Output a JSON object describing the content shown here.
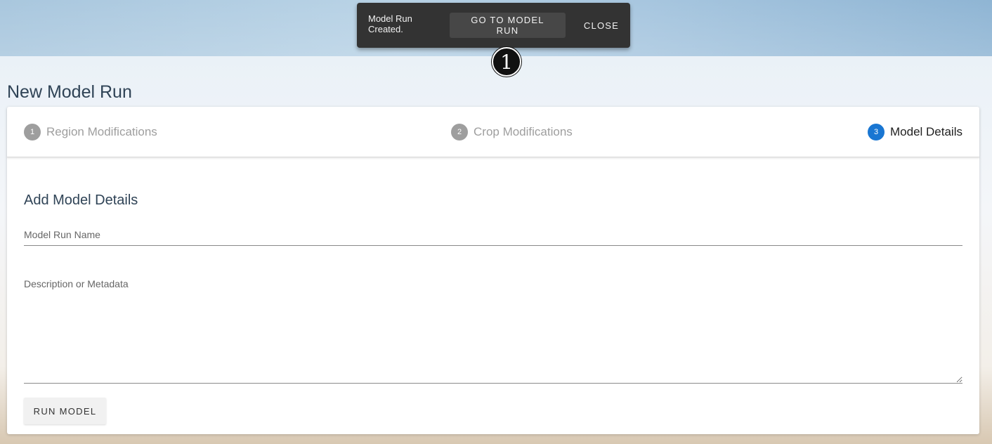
{
  "snackbar": {
    "message": "Model Run Created.",
    "go_label": "GO TO MODEL RUN",
    "close_label": "CLOSE"
  },
  "marker": {
    "number": "1"
  },
  "page": {
    "title": "New Model Run"
  },
  "stepper": {
    "steps": [
      {
        "number": "1",
        "label": "Region Modifications",
        "state": "inactive"
      },
      {
        "number": "2",
        "label": "Crop Modifications",
        "state": "inactive"
      },
      {
        "number": "3",
        "label": "Model Details",
        "state": "active"
      }
    ]
  },
  "form": {
    "section_title": "Add Model Details",
    "name_placeholder": "Model Run Name",
    "name_value": "",
    "description_placeholder": "Description or Metadata",
    "description_value": "",
    "submit_label": "RUN MODEL"
  },
  "colors": {
    "active_step": "#1976d2",
    "inactive_step": "#9e9e9e",
    "snackbar_bg": "#333333",
    "title_text": "#2f4356"
  }
}
